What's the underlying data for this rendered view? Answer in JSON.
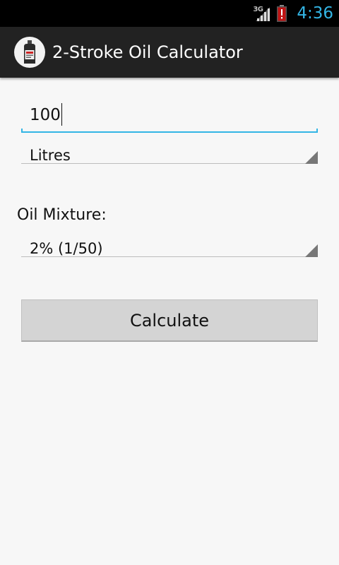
{
  "status_bar": {
    "network_type": "3G",
    "clock": "4:36",
    "icons": [
      "signal-icon",
      "battery-alert-icon"
    ]
  },
  "action_bar": {
    "app_icon": "oil-bottle-icon",
    "title": "2-Stroke Oil Calculator"
  },
  "form": {
    "amount_value": "100",
    "unit_selected": "Litres",
    "mixture_label": "Oil Mixture:",
    "mixture_selected": "2% (1/50)",
    "calculate_label": "Calculate"
  },
  "colors": {
    "accent": "#33b5e5",
    "action_bar": "#222222",
    "background": "#f7f7f7",
    "button": "#d4d4d4"
  }
}
